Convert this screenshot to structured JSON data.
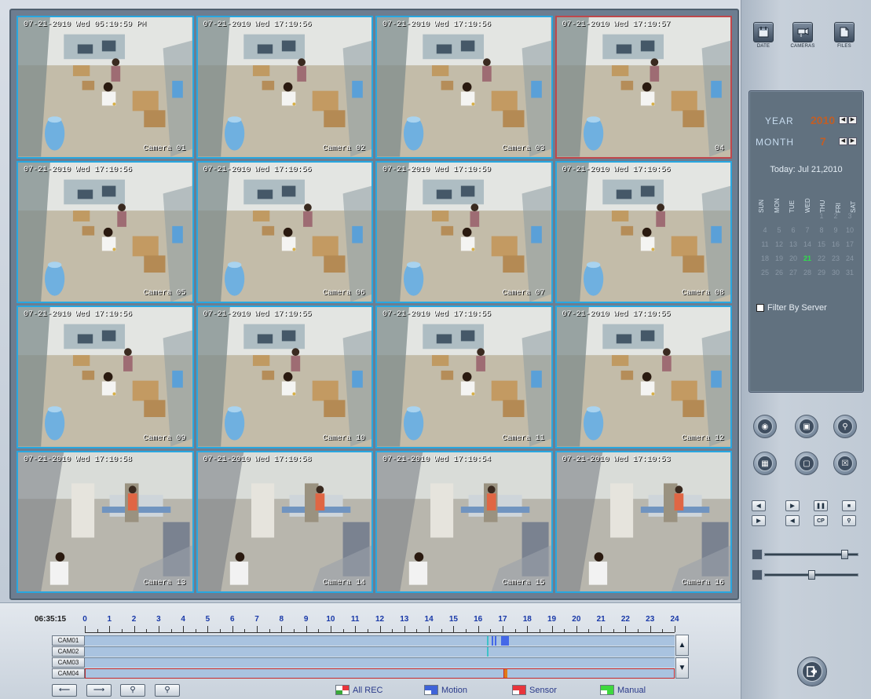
{
  "toolbar": {
    "date_label": "DATE",
    "cameras_label": "CAMERAS",
    "files_label": "FILES"
  },
  "cameras": [
    {
      "timestamp": "07-21-2010 Wed 05:10:59 PM",
      "label": "Camera 01"
    },
    {
      "timestamp": "07-21-2010 Wed 17:10:56",
      "label": "Camera 02"
    },
    {
      "timestamp": "07-21-2010 Wed 17:10:56",
      "label": "Camera 03"
    },
    {
      "timestamp": "07-21-2010 Wed 17:10:57",
      "label": "04"
    },
    {
      "timestamp": "07-21-2010 Wed 17:10:56",
      "label": "Camera 05"
    },
    {
      "timestamp": "07-21-2010 Wed 17:10:56",
      "label": "Camera 06"
    },
    {
      "timestamp": "07-21-2010 Wed 17:10:59",
      "label": "Camera 07"
    },
    {
      "timestamp": "07-21-2010 Wed 17:10:56",
      "label": "Camera 08"
    },
    {
      "timestamp": "07-21-2010 Wed 17:10:56",
      "label": "Camera 09"
    },
    {
      "timestamp": "07-21-2010 Wed 17:10:55",
      "label": "Camera 10"
    },
    {
      "timestamp": "07-21-2010 Wed 17:10:55",
      "label": "Camera 11"
    },
    {
      "timestamp": "07-21-2010 Wed 17:10:55",
      "label": "Camera 12"
    },
    {
      "timestamp": "07-21-2010 Wed 17:10:58",
      "label": "Camera 13"
    },
    {
      "timestamp": "07-21-2010 Wed 17:10:58",
      "label": "Camera 14"
    },
    {
      "timestamp": "07-21-2010 Wed 17:10:54",
      "label": "Camera 15"
    },
    {
      "timestamp": "07-21-2010 Wed 17:10:53",
      "label": "Camera 16"
    }
  ],
  "selected_camera_index": 3,
  "calendar": {
    "year_label": "YEAR",
    "year": "2010",
    "month_label": "MONTH",
    "month": "7",
    "today_text": "Today: Jul 21,2010",
    "weekdays": [
      "SUN",
      "MON",
      "TUE",
      "WED",
      "THU",
      "FRI",
      "SAT"
    ],
    "first_weekday": 4,
    "days_in_month": 31,
    "today_day": 21,
    "filter_label": "Filter By Server",
    "filter_checked": false
  },
  "controls": {
    "round_buttons": [
      "snapshot-icon",
      "record-icon",
      "zoom-search-icon",
      "grid-layout-icon",
      "fullscreen-icon",
      "close-box-icon"
    ],
    "playback_buttons": [
      "step-back-icon",
      "step-forward-icon",
      "pause-icon",
      "stop-icon",
      "play-icon",
      "reverse-icon",
      "cp-icon",
      "search-frame-icon"
    ],
    "cp_label": "CP",
    "volume_level": 0.88,
    "speed_level": 0.5
  },
  "timeline": {
    "clock": "06:35:15",
    "hours": [
      "0",
      "1",
      "2",
      "3",
      "4",
      "5",
      "6",
      "7",
      "8",
      "9",
      "10",
      "11",
      "12",
      "13",
      "14",
      "15",
      "16",
      "17",
      "18",
      "19",
      "20",
      "21",
      "22",
      "23",
      "24"
    ],
    "tracks": [
      {
        "name": "CAM01",
        "segments": [
          {
            "start": 16.35,
            "end": 16.42,
            "color": "#3ec2c8"
          },
          {
            "start": 16.55,
            "end": 16.6,
            "color": "#4468e8"
          },
          {
            "start": 16.68,
            "end": 16.73,
            "color": "#4468e8"
          },
          {
            "start": 16.95,
            "end": 17.25,
            "color": "#4468e8"
          }
        ]
      },
      {
        "name": "CAM02",
        "segments": [
          {
            "start": 16.35,
            "end": 16.42,
            "color": "#3ec2c8"
          }
        ]
      },
      {
        "name": "CAM03",
        "segments": []
      },
      {
        "name": "CAM04",
        "segments": [
          {
            "start": 17.0,
            "end": 17.15,
            "color": "#e07a18"
          }
        ]
      }
    ],
    "selected_track": 3,
    "cursor_hour": 17.0
  },
  "legend": [
    {
      "label": "All REC",
      "colors": [
        "#ffffff",
        "#e8353c",
        "#3aa83a",
        "#ffffff"
      ]
    },
    {
      "label": "Motion",
      "colors": [
        "#3f63d8",
        "#3f63d8",
        "#ffffff",
        "#3f63d8"
      ]
    },
    {
      "label": "Sensor",
      "colors": [
        "#e8353c",
        "#e8353c",
        "#ffffff",
        "#e8353c"
      ]
    },
    {
      "label": "Manual",
      "colors": [
        "#3fd83f",
        "#3fd83f",
        "#ffffff",
        "#3fd83f"
      ]
    }
  ],
  "nav": [
    "arrow-left-icon",
    "arrow-right-icon",
    "zoom-in-icon",
    "zoom-out-icon"
  ]
}
